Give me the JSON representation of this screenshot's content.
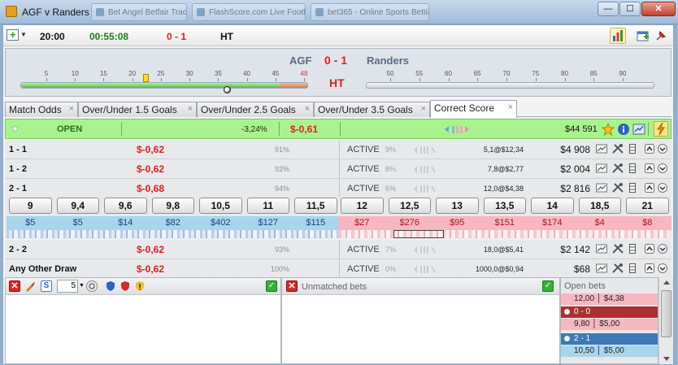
{
  "window": {
    "title": "AGF v Randers",
    "background_tabs": [
      "Bet Angel Betfair Trading Software",
      "FlashScore.com Live Football Scores",
      "bet365 - Online Sports Betting"
    ],
    "minimize": "—",
    "maximize": "☐",
    "close": "✕"
  },
  "toolbar": {
    "kickoff": "20:00",
    "elapsed": "00:55:08",
    "score": "0 - 1",
    "period": "HT"
  },
  "match": {
    "home": "AGF",
    "away": "Randers",
    "score": "0 - 1",
    "period": "HT",
    "first_half_ticks": [
      "5",
      "10",
      "15",
      "20",
      "25",
      "30",
      "35",
      "40",
      "45",
      "48"
    ],
    "second_half_ticks": [
      "50",
      "55",
      "60",
      "65",
      "70",
      "75",
      "80",
      "85",
      "90"
    ],
    "first_half_progress": 1.0
  },
  "tabs": [
    {
      "label": "Match Odds",
      "active": false
    },
    {
      "label": "Over/Under 1.5 Goals",
      "active": false
    },
    {
      "label": "Over/Under 2.5 Goals",
      "active": false
    },
    {
      "label": "Over/Under 3.5 Goals",
      "active": false
    },
    {
      "label": "Correct Score",
      "active": true
    }
  ],
  "tab_close": "×",
  "market": {
    "status": "OPEN",
    "overround": "-3,24%",
    "pl": "$-0,61",
    "matched": "$44 591"
  },
  "selections": [
    {
      "name": "1 - 1",
      "pl": "$-0,62",
      "pct": "91%",
      "status": "ACTIVE",
      "status_pct": "9%",
      "last": "5,1@$12,34",
      "volume": "$4 908"
    },
    {
      "name": "1 - 2",
      "pl": "$-0,62",
      "pct": "92%",
      "status": "ACTIVE",
      "status_pct": "8%",
      "last": "7,8@$2,77",
      "volume": "$2 004"
    },
    {
      "name": "2 - 1",
      "pl": "$-0,68",
      "pct": "94%",
      "status": "ACTIVE",
      "status_pct": "6%",
      "last": "12,0@$4,38",
      "volume": "$2 816"
    },
    {
      "name": "2 - 2",
      "pl": "$-0,62",
      "pct": "93%",
      "status": "ACTIVE",
      "status_pct": "7%",
      "last": "18,0@$5,41",
      "volume": "$2 142"
    },
    {
      "name": "Any Other Draw",
      "pl": "$-0,62",
      "pct": "100%",
      "status": "ACTIVE",
      "status_pct": "0%",
      "last": "1000,0@$0,94",
      "volume": "$68"
    }
  ],
  "ladder": {
    "back": [
      {
        "odds": "9",
        "amount": "$5"
      },
      {
        "odds": "9,4",
        "amount": "$5"
      },
      {
        "odds": "9,6",
        "amount": "$14"
      },
      {
        "odds": "9,8",
        "amount": "$82"
      },
      {
        "odds": "10,5",
        "amount": "$402"
      },
      {
        "odds": "11",
        "amount": "$127"
      },
      {
        "odds": "11,5",
        "amount": "$115"
      }
    ],
    "lay": [
      {
        "odds": "12",
        "amount": "$27"
      },
      {
        "odds": "12,5",
        "amount": "$276"
      },
      {
        "odds": "13",
        "amount": "$95"
      },
      {
        "odds": "13,5",
        "amount": "$151"
      },
      {
        "odds": "14",
        "amount": "$174"
      },
      {
        "odds": "18,5",
        "amount": "$4"
      },
      {
        "odds": "21",
        "amount": "$8"
      }
    ]
  },
  "bet_panel": {
    "stake_spinner": "5",
    "check": "✓"
  },
  "unmatched": {
    "title": "Unmatched bets"
  },
  "open_bets": {
    "title": "Open bets",
    "items": [
      {
        "odds_line": "12,00 │ $4,38",
        "side": "lay",
        "selection": null
      },
      {
        "odds_line": "9,80 │ $5,00",
        "side": "lay",
        "selection": "0 - 0"
      },
      {
        "odds_line": "10,50 │ $5,00",
        "side": "back",
        "selection": "2 - 1"
      }
    ]
  },
  "colors": {
    "accent_red": "#e02020",
    "open_green": "#a8f48c",
    "back_blue": "#a8d5ea",
    "lay_pink": "#f6b7c0"
  }
}
